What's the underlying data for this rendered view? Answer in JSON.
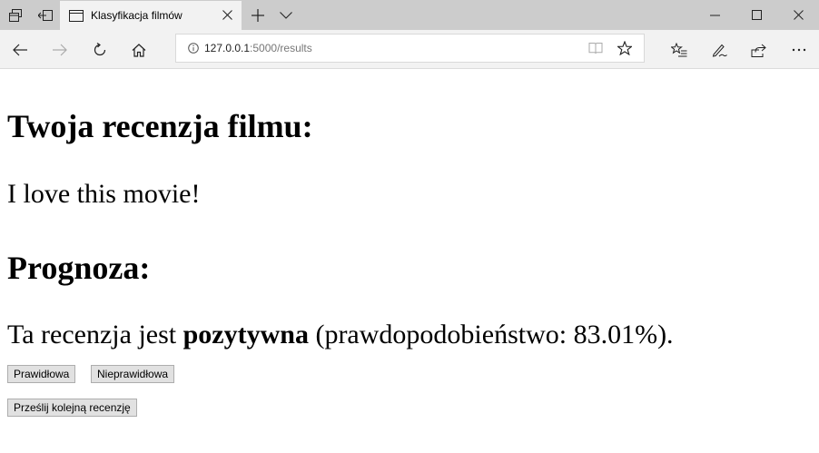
{
  "browser": {
    "tab": {
      "title": "Klasyfikacja filmów"
    },
    "address": {
      "host": "127.0.0.1",
      "path": ":5000/results"
    },
    "icons": {
      "tab_manager": "tab-manager-icon",
      "set_aside": "set-aside-tabs-icon",
      "page": "page-icon",
      "new_tab": "plus-icon",
      "tab_list": "chevron-down-icon",
      "minimize": "minimize-icon",
      "maximize": "maximize-icon",
      "close": "close-icon",
      "back": "back-arrow-icon",
      "forward": "forward-arrow-icon",
      "refresh": "refresh-icon",
      "home": "home-icon",
      "info": "info-icon",
      "reading_view": "reading-view-icon",
      "favorite": "star-icon",
      "favorites_hub": "favorites-hub-icon",
      "notes": "pen-icon",
      "share": "share-icon",
      "more": "more-icon"
    }
  },
  "page": {
    "review_heading": "Twoja recenzja filmu:",
    "review_text": "I love this movie!",
    "prediction_heading": "Prognoza:",
    "prediction": {
      "prefix": "Ta recenzja jest ",
      "label": "pozytywna",
      "suffix": " (prawdopodobieństwo: 83.01%)."
    },
    "buttons": {
      "correct": "Prawidłowa",
      "incorrect": "Nieprawidłowa",
      "submit_another": "Prześlij kolejną recenzję"
    }
  }
}
